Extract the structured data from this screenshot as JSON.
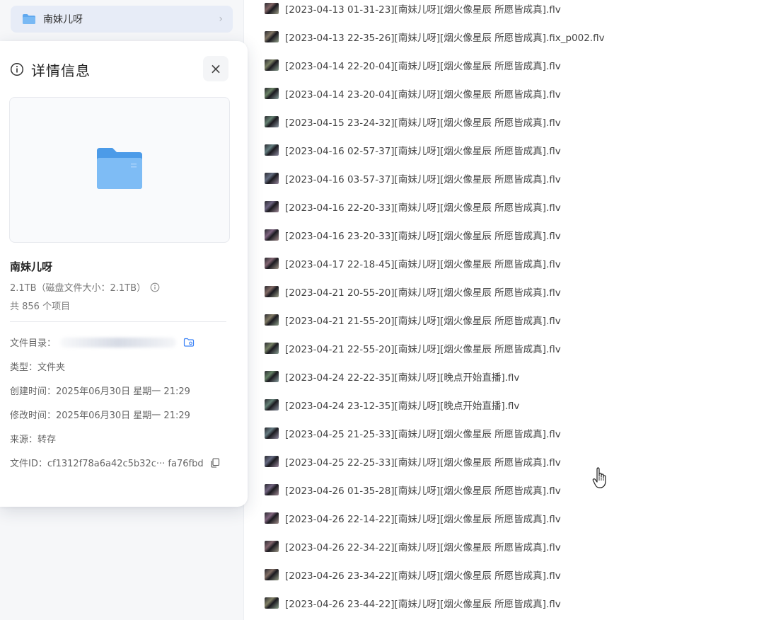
{
  "sidebar": {
    "current_folder": "南妹儿呀",
    "chevron": "›"
  },
  "details": {
    "title": "详情信息",
    "close_symbol": "×",
    "name": "南妹儿呀",
    "size": "2.1TB（磁盘文件大小：2.1TB）",
    "count": "共 856 个项目",
    "dir_label": "文件目录：",
    "type": "类型：文件夹",
    "created": "创建时间：2025年06月30日 星期一 21:29",
    "modified": "修改时间：2025年06月30日 星期一 21:29",
    "source": "来源：转存",
    "file_id": "文件ID：cf1312f78a6a42c5b32c··· fa76fbd"
  },
  "icons": {
    "info": "info-circle-icon",
    "close": "close-icon",
    "folder": "folder-icon",
    "locate": "folder-locate-icon",
    "copy": "copy-icon",
    "cursor": "hand-pointer-icon"
  },
  "colors": {
    "folder_blue": "#5fa8ef",
    "chip_bg": "#e7ecf7"
  },
  "files": [
    "[2023-04-13 01-31-23][南妹儿呀][烟火像星辰 所愿皆成真].flv",
    "[2023-04-13 22-35-26][南妹儿呀][烟火像星辰 所愿皆成真].fix_p002.flv",
    "[2023-04-14 22-20-04][南妹儿呀][烟火像星辰 所愿皆成真].flv",
    "[2023-04-14 23-20-04][南妹儿呀][烟火像星辰 所愿皆成真].flv",
    "[2023-04-15 23-24-32][南妹儿呀][烟火像星辰 所愿皆成真].flv",
    "[2023-04-16 02-57-37][南妹儿呀][烟火像星辰 所愿皆成真].flv",
    "[2023-04-16 03-57-37][南妹儿呀][烟火像星辰 所愿皆成真].flv",
    "[2023-04-16 22-20-33][南妹儿呀][烟火像星辰 所愿皆成真].flv",
    "[2023-04-16 23-20-33][南妹儿呀][烟火像星辰 所愿皆成真].flv",
    "[2023-04-17 22-18-45][南妹儿呀][烟火像星辰 所愿皆成真].flv",
    "[2023-04-21 20-55-20][南妹儿呀][烟火像星辰 所愿皆成真].flv",
    "[2023-04-21 21-55-20][南妹儿呀][烟火像星辰 所愿皆成真].flv",
    "[2023-04-21 22-55-20][南妹儿呀][烟火像星辰 所愿皆成真].flv",
    "[2023-04-24 22-22-35][南妹儿呀][晚点开始直播].flv",
    "[2023-04-24 23-12-35][南妹儿呀][晚点开始直播].flv",
    "[2023-04-25 21-25-33][南妹儿呀][烟火像星辰 所愿皆成真].flv",
    "[2023-04-25 22-25-33][南妹儿呀][烟火像星辰 所愿皆成真].flv",
    "[2023-04-26 01-35-28][南妹儿呀][烟火像星辰 所愿皆成真].flv",
    "[2023-04-26 22-14-22][南妹儿呀][烟火像星辰 所愿皆成真].flv",
    "[2023-04-26 22-34-22][南妹儿呀][烟火像星辰 所愿皆成真].flv",
    "[2023-04-26 23-34-22][南妹儿呀][烟火像星辰 所愿皆成真].flv",
    "[2023-04-26 23-44-22][南妹儿呀][烟火像星辰 所愿皆成真].flv"
  ]
}
